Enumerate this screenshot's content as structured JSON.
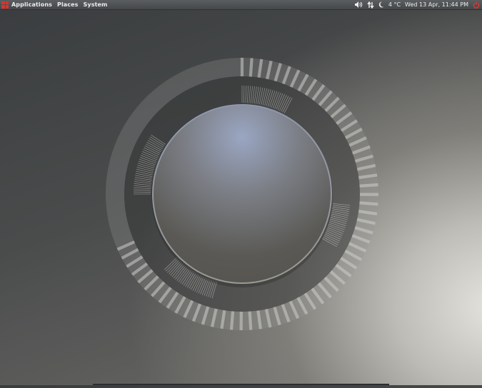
{
  "topbar": {
    "menus": [
      {
        "label": "Applications"
      },
      {
        "label": "Places"
      },
      {
        "label": "System"
      }
    ],
    "indicators": {
      "volume_icon": "volume-icon",
      "network_icon": "network-transfer-icon",
      "weather_icon": "moon-icon",
      "temperature": "4 °C",
      "clock": "Wed 13 Apr, 11:44 PM",
      "power_icon": "power-icon"
    }
  },
  "colors": {
    "accent": "#d9342b",
    "panel": "#4f5254",
    "panel_text": "#ececec"
  },
  "desktop": {
    "widget": "circular-system-monitor"
  }
}
